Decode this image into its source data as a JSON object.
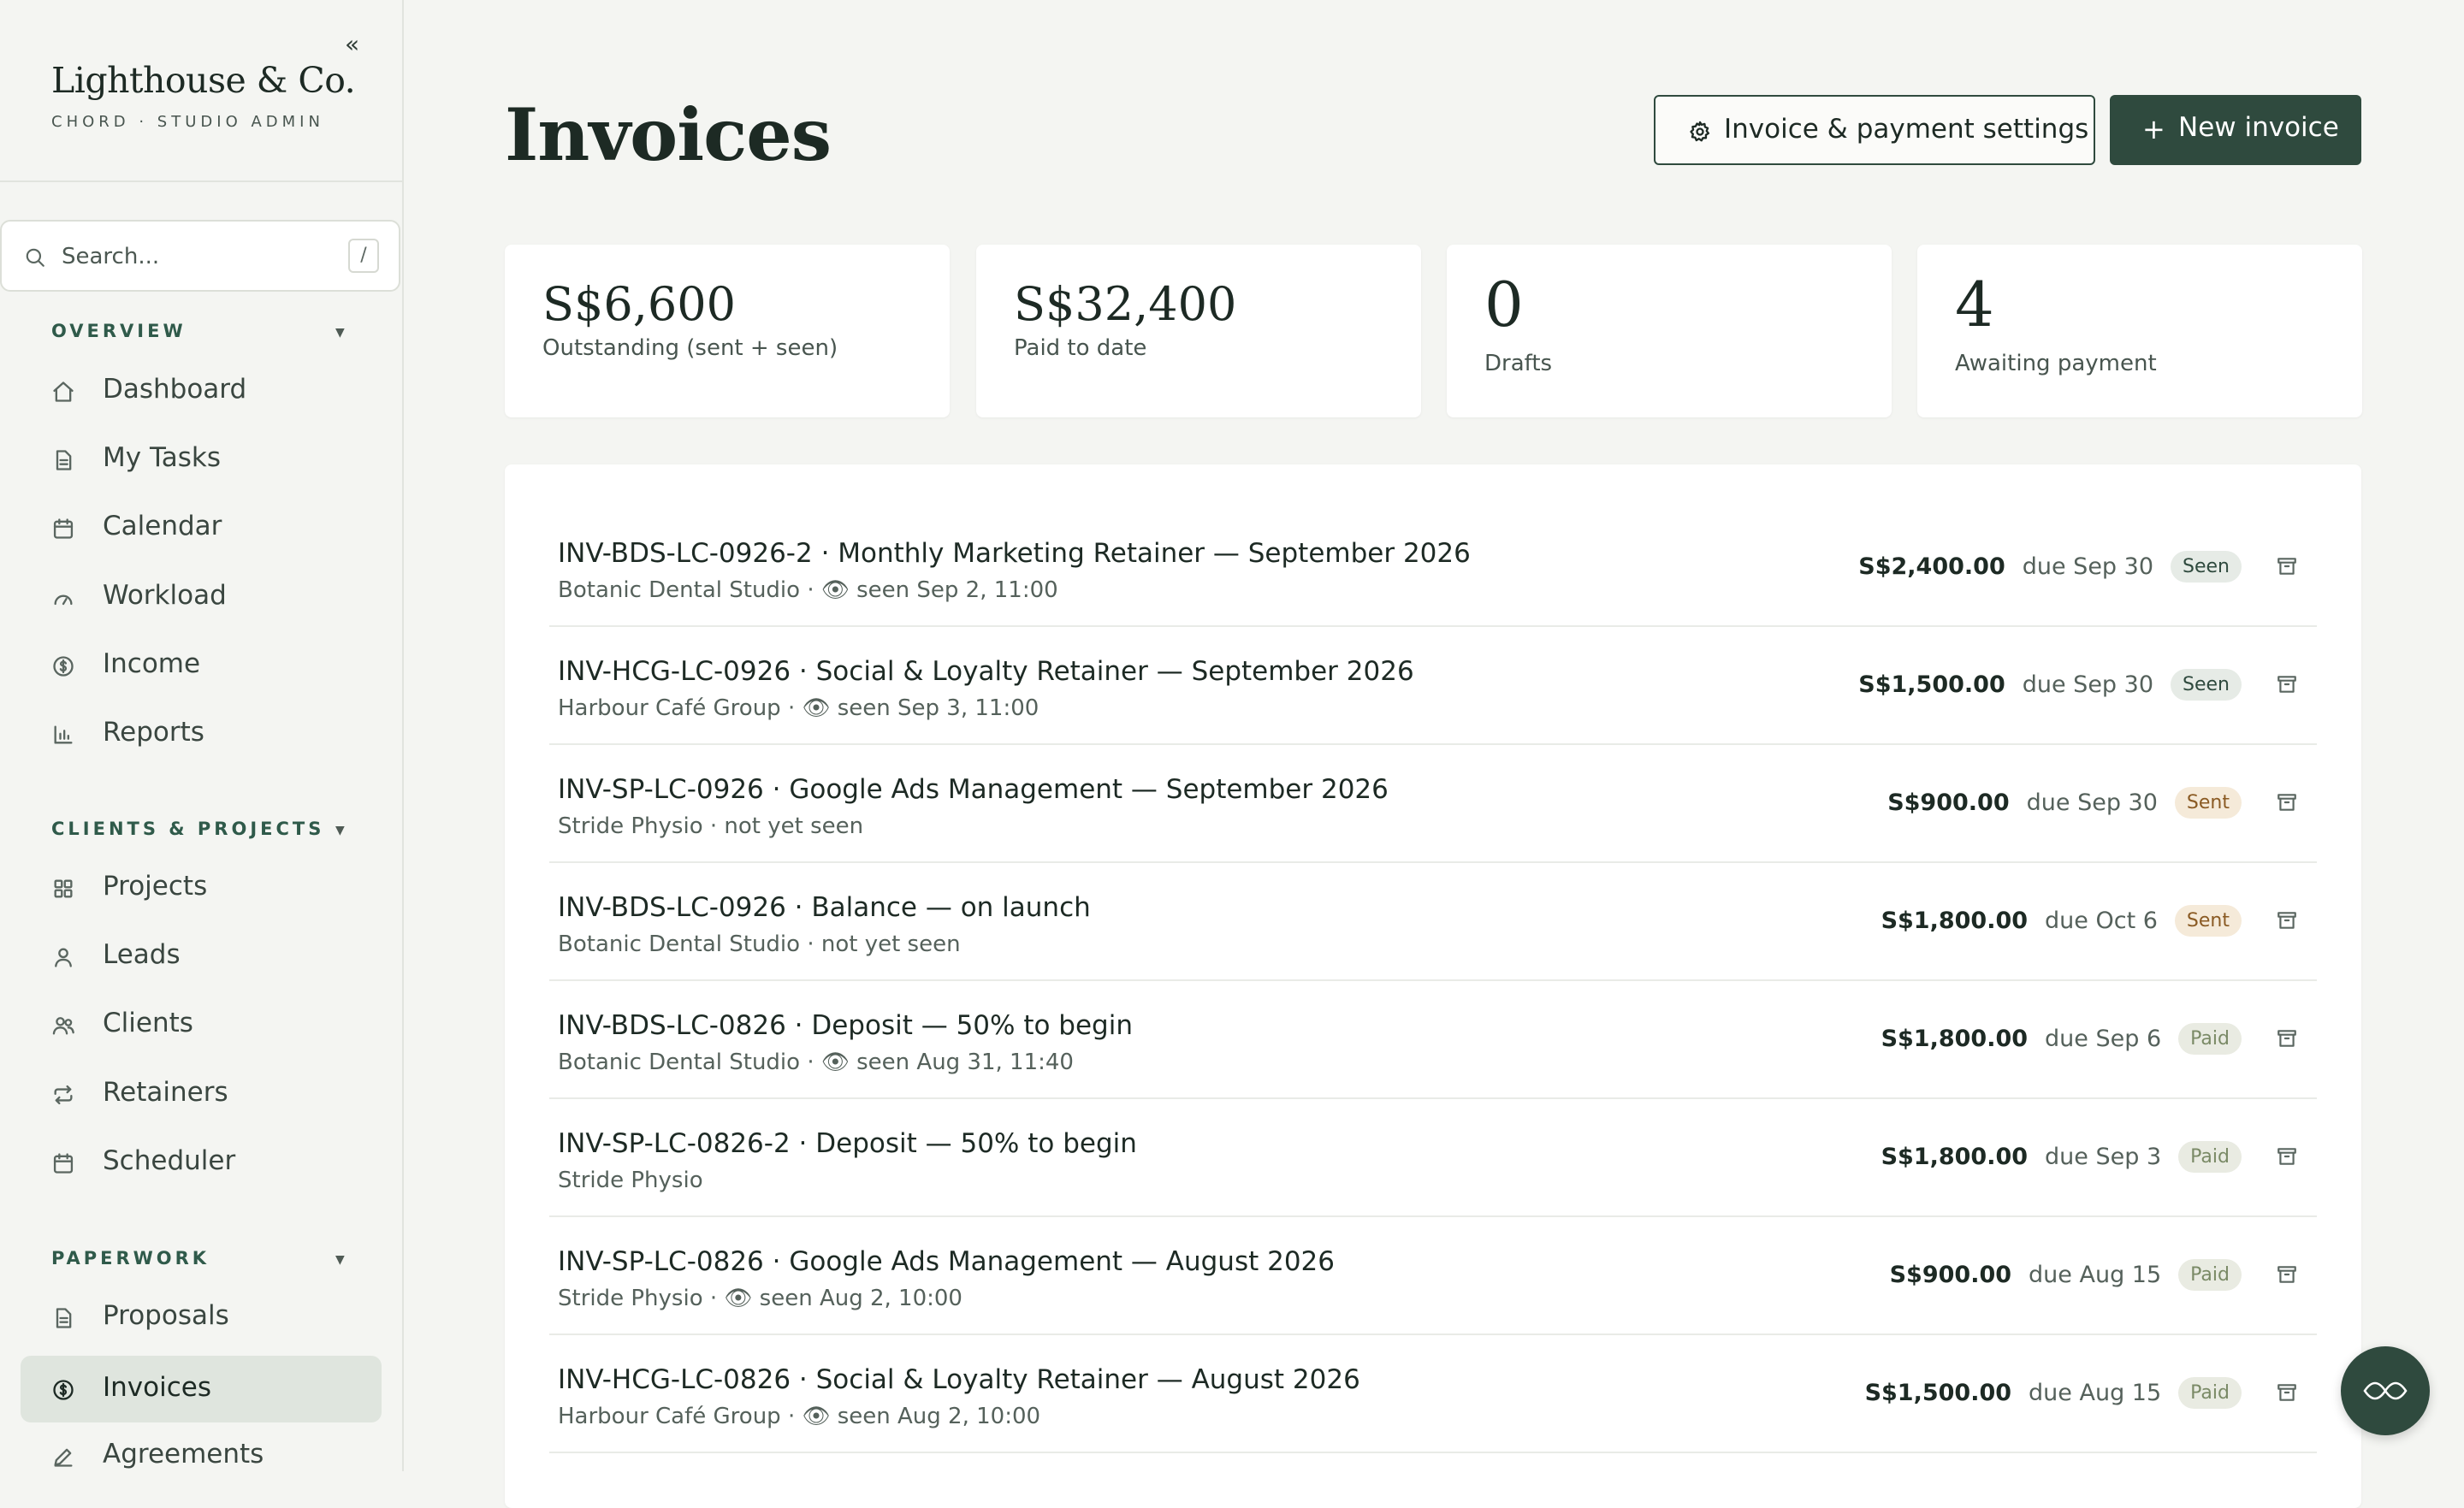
{
  "sidebar": {
    "brand_name": "Lighthouse & Co.",
    "brand_sub": "CHORD · STUDIO ADMIN",
    "collapse_glyph": "«",
    "search_placeholder": "Search...",
    "search_shortcut": "/",
    "sections": {
      "overview": "OVERVIEW",
      "clients_projects": "CLIENTS & PROJECTS",
      "paperwork": "PAPERWORK"
    },
    "items": [
      {
        "label": "Dashboard",
        "icon": "home-icon"
      },
      {
        "label": "My Tasks",
        "icon": "document-icon"
      },
      {
        "label": "Calendar",
        "icon": "calendar-icon"
      },
      {
        "label": "Workload",
        "icon": "gauge-icon"
      },
      {
        "label": "Income",
        "icon": "dollar-circle-icon"
      },
      {
        "label": "Reports",
        "icon": "bar-chart-icon"
      },
      {
        "label": "Projects",
        "icon": "grid-icon"
      },
      {
        "label": "Leads",
        "icon": "user-icon"
      },
      {
        "label": "Clients",
        "icon": "users-icon"
      },
      {
        "label": "Retainers",
        "icon": "repeat-icon"
      },
      {
        "label": "Scheduler",
        "icon": "calendar-icon"
      },
      {
        "label": "Proposals",
        "icon": "document-icon"
      },
      {
        "label": "Invoices",
        "icon": "dollar-circle-icon",
        "active": true
      },
      {
        "label": "Agreements",
        "icon": "pen-icon"
      }
    ]
  },
  "header": {
    "title": "Invoices",
    "settings_label": "Invoice & payment settings",
    "new_invoice_label": "New invoice"
  },
  "stats": [
    {
      "value": "S$6,600",
      "label": "Outstanding (sent + seen)"
    },
    {
      "value": "S$32,400",
      "label": "Paid to date"
    },
    {
      "value": "0",
      "label": "Drafts"
    },
    {
      "value": "4",
      "label": "Awaiting payment"
    }
  ],
  "invoices": [
    {
      "title": "INV-BDS-LC-0926-2 · Monthly Marketing Retainer — September 2026",
      "sub": "Botanic Dental Studio · 👁 seen Sep 2, 11:00",
      "amount": "S$2,400.00",
      "due": "due Sep 30",
      "status": "Seen"
    },
    {
      "title": "INV-HCG-LC-0926 · Social & Loyalty Retainer — September 2026",
      "sub": "Harbour Café Group · 👁 seen Sep 3, 11:00",
      "amount": "S$1,500.00",
      "due": "due Sep 30",
      "status": "Seen"
    },
    {
      "title": "INV-SP-LC-0926 · Google Ads Management — September 2026",
      "sub": "Stride Physio · not yet seen",
      "amount": "S$900.00",
      "due": "due Sep 30",
      "status": "Sent"
    },
    {
      "title": "INV-BDS-LC-0926 · Balance — on launch",
      "sub": "Botanic Dental Studio · not yet seen",
      "amount": "S$1,800.00",
      "due": "due Oct 6",
      "status": "Sent"
    },
    {
      "title": "INV-BDS-LC-0826 · Deposit — 50% to begin",
      "sub": "Botanic Dental Studio · 👁 seen Aug 31, 11:40",
      "amount": "S$1,800.00",
      "due": "due Sep 6",
      "status": "Paid"
    },
    {
      "title": "INV-SP-LC-0826-2 · Deposit — 50% to begin",
      "sub": "Stride Physio",
      "amount": "S$1,800.00",
      "due": "due Sep 3",
      "status": "Paid"
    },
    {
      "title": "INV-SP-LC-0826 · Google Ads Management — August 2026",
      "sub": "Stride Physio · 👁 seen Aug 2, 10:00",
      "amount": "S$900.00",
      "due": "due Aug 15",
      "status": "Paid"
    },
    {
      "title": "INV-HCG-LC-0826 · Social & Loyalty Retainer — August 2026",
      "sub": "Harbour Café Group · 👁 seen Aug 2, 10:00",
      "amount": "S$1,500.00",
      "due": "due Aug 15",
      "status": "Paid"
    }
  ],
  "colors": {
    "accent": "#2f4a3e",
    "background": "#f4f5f2",
    "seen_badge": "#e6ebe6",
    "sent_badge": "#f5ead9",
    "paid_badge": "#e9ebe2"
  }
}
